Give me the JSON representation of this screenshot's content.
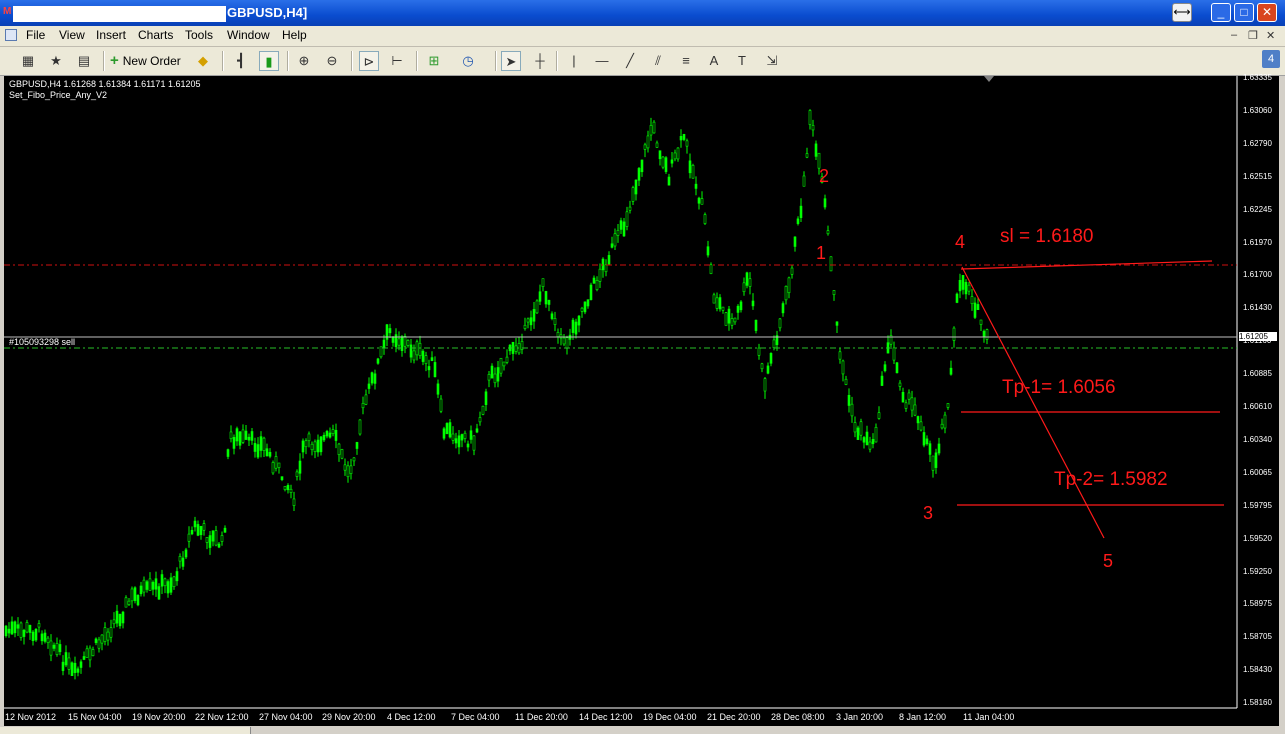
{
  "window": {
    "title": "GBPUSD,H4]",
    "minimize": "_",
    "maximize": "□",
    "close": "✕",
    "extra": "⟷"
  },
  "menu": [
    "File",
    "View",
    "Insert",
    "Charts",
    "Tools",
    "Window",
    "Help"
  ],
  "mdi": {
    "min": "–",
    "restore": "❐",
    "close": "✕"
  },
  "toolbar": {
    "new_order": "New Order",
    "badge": "4"
  },
  "chart": {
    "symbol_line": "GBPUSD,H4  1.61268 1.61384 1.61171 1.61205",
    "indicator": "Set_Fibo_Price_Any_V2",
    "order_label": "#105093298 sell",
    "current_price": "1.61205",
    "price_labels": [
      "1.63335",
      "1.63060",
      "1.62790",
      "1.62515",
      "1.62245",
      "1.61970",
      "1.61700",
      "1.61430",
      "1.61160",
      "1.60885",
      "1.60610",
      "1.60340",
      "1.60065",
      "1.59795",
      "1.59520",
      "1.59250",
      "1.58975",
      "1.58705",
      "1.58430",
      "1.58160"
    ],
    "time_labels": [
      "12 Nov 2012",
      "15 Nov 04:00",
      "19 Nov 20:00",
      "22 Nov 12:00",
      "27 Nov 04:00",
      "29 Nov 20:00",
      "4 Dec 12:00",
      "7 Dec 04:00",
      "11 Dec 20:00",
      "14 Dec 12:00",
      "19 Dec 04:00",
      "21 Dec 20:00",
      "28 Dec 08:00",
      "3 Jan 20:00",
      "8 Jan 12:00",
      "11 Jan 04:00"
    ],
    "annotations": {
      "sl": "sl = 1.6180",
      "tp1": "Tp-1= 1.6056",
      "tp2": "Tp-2= 1.5982"
    },
    "waves": [
      "1",
      "2",
      "3",
      "4",
      "5"
    ],
    "colors": {
      "candles": "#00ff00",
      "annotations": "#ff1a1a",
      "background": "#000000"
    }
  }
}
